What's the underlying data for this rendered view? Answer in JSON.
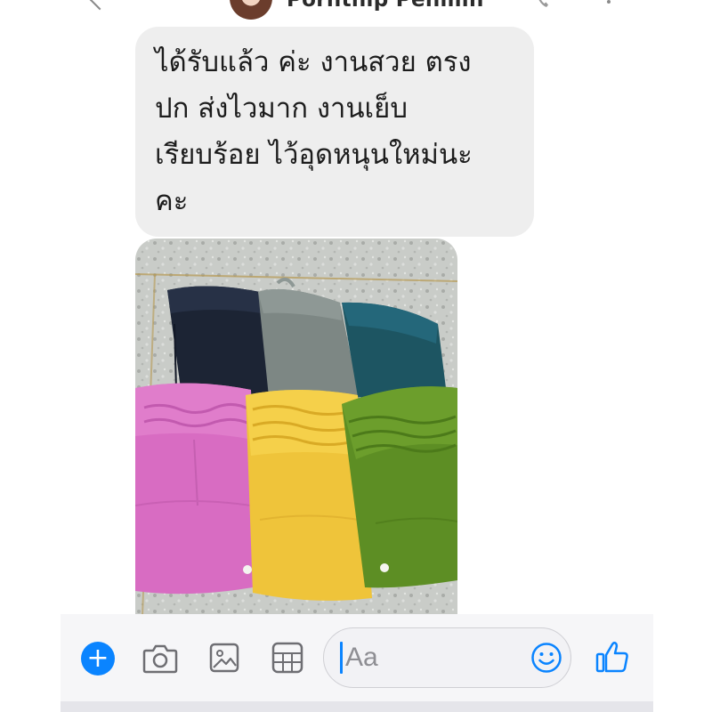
{
  "header": {
    "contact_name": "Pornthip Penmin",
    "call_icon": "phone-icon",
    "menu_icon": "more-icon"
  },
  "message": {
    "lines": [
      "ได้รับแล้ว ค่ะ งานสวย ตรง",
      "ปก ส่งไวมาก  งานเย็บ",
      "เรียบร้อย ไว้อุดหนุนใหม่นะ",
      "คะ"
    ]
  },
  "photo": {
    "subject": "six folded shorts",
    "colors": {
      "navy": "#1c2434",
      "gray": "#7d8784",
      "teal": "#1d5562",
      "pink": "#d86cc2",
      "yellow": "#efc43a",
      "green": "#5d8e24"
    }
  },
  "composer": {
    "placeholder": "Aa",
    "icons": [
      "plus-icon",
      "camera-icon",
      "image-icon",
      "sticker-icon",
      "emoji-icon",
      "thumbs-up-icon"
    ],
    "accent_color": "#0a84ff"
  }
}
